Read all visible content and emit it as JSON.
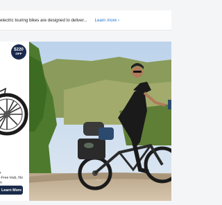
{
  "banner": {
    "text": "electric touring bikes are designed to deliver...",
    "link_label": "Learn more ›"
  },
  "promo_card": {
    "badge_amount": "$220",
    "badge_suffix": "OFF",
    "desc_line1": "r",
    "desc_line2": "-Free Hub, No",
    "desc_line3": "n",
    "button_label": "Learn More",
    "accent_color": "#1b2b4a"
  },
  "hero": {
    "image_subject": "rider on loaded electric touring bike on dirt road"
  }
}
